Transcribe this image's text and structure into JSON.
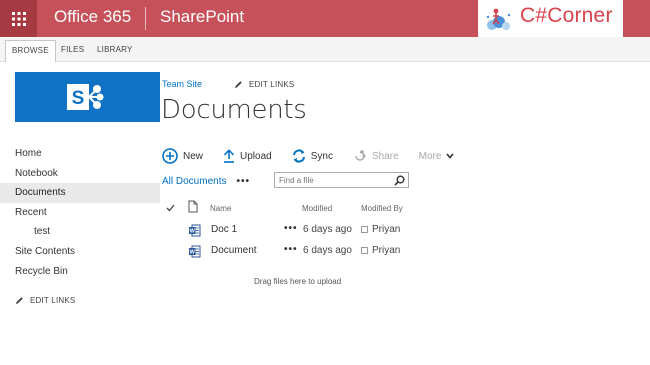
{
  "suite": {
    "brand": "Office 365",
    "app": "SharePoint",
    "partner_logo": "C#Corner",
    "bar_color": "#c7515a"
  },
  "ribbon": {
    "tabs": [
      {
        "label": "BROWSE",
        "selected": true
      },
      {
        "label": "FILES",
        "selected": false
      },
      {
        "label": "LIBRARY",
        "selected": false
      }
    ]
  },
  "site": {
    "logo_icon": "sharepoint-logo-icon",
    "logo_color": "#0f72c5"
  },
  "nav": {
    "items": [
      {
        "label": "Home",
        "selected": false
      },
      {
        "label": "Notebook",
        "selected": false
      },
      {
        "label": "Documents",
        "selected": true
      },
      {
        "label": "Recent",
        "selected": false
      },
      {
        "label": "test",
        "selected": false
      },
      {
        "label": "Site Contents",
        "selected": false
      },
      {
        "label": "Recycle Bin",
        "selected": false
      }
    ],
    "edit_links": "EDIT LINKS"
  },
  "header": {
    "breadcrumb": "Team Site",
    "edit_links": "EDIT LINKS",
    "title": "Documents"
  },
  "commands": {
    "new": "New",
    "upload": "Upload",
    "sync": "Sync",
    "share": "Share",
    "more": "More"
  },
  "view": {
    "current": "All Documents",
    "more": "•••",
    "search_placeholder": "Find a file"
  },
  "table": {
    "columns": {
      "name": "Name",
      "modified": "Modified",
      "modified_by": "Modified By"
    },
    "rows": [
      {
        "name": "Doc 1",
        "modified": "6 days ago",
        "modified_by": "Priyan"
      },
      {
        "name": "Document",
        "modified": "6 days ago",
        "modified_by": "Priyan"
      }
    ],
    "ellipsis": "•••"
  },
  "drop_hint": "Drag files here to upload",
  "colors": {
    "accent": "#0072c6"
  }
}
